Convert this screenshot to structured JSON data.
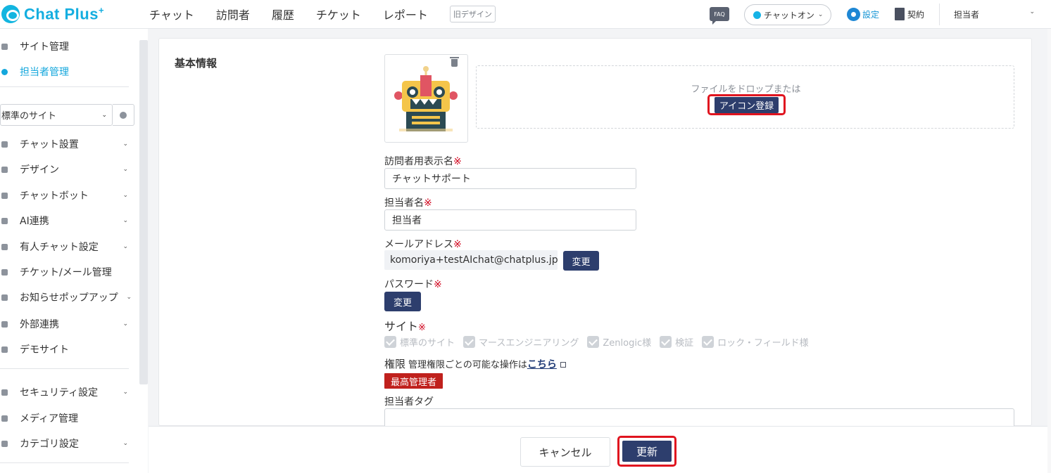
{
  "app": {
    "logo_text": "Chat Plus",
    "logo_sup": "+"
  },
  "nav": {
    "items": [
      "チャット",
      "訪問者",
      "履歴",
      "チケット",
      "レポート"
    ],
    "old_design": "旧デザイン"
  },
  "header": {
    "faq": "FAQ",
    "status": "チャットオン",
    "settings": "設定",
    "contract": "契約",
    "user": "担当者"
  },
  "sidebar": {
    "top_items": [
      {
        "label": "サイト管理"
      },
      {
        "label": "担当者管理"
      }
    ],
    "site_select": "標準のサイト",
    "items": [
      {
        "label": "チャット設置"
      },
      {
        "label": "デザイン"
      },
      {
        "label": "チャットボット"
      },
      {
        "label": "AI連携"
      },
      {
        "label": "有人チャット設定"
      },
      {
        "label": "チケット/メール管理"
      },
      {
        "label": "お知らせポップアップ"
      },
      {
        "label": "外部連携"
      },
      {
        "label": "デモサイト"
      }
    ],
    "bottom_items": [
      {
        "label": "セキュリティ設定"
      },
      {
        "label": "メディア管理"
      },
      {
        "label": "カテゴリ設定"
      }
    ]
  },
  "form": {
    "section_title": "基本情報",
    "drop_text": "ファイルをドロップまたは",
    "icon_register": "アイコン登録",
    "visitor_name_label": "訪問者用表示名",
    "visitor_name_value": "チャットサポート",
    "operator_name_label": "担当者名",
    "operator_name_value": "担当者",
    "email_label": "メールアドレス",
    "email_value": "komoriya+testAIchat@chatplus.jp",
    "change_label": "変更",
    "password_label": "パスワード",
    "required_mark": "※",
    "site_label": "サイト",
    "sites": [
      "標準のサイト",
      "マースエンジニアリング",
      "Zenlogic様",
      "検証",
      "ロック・フィールド様"
    ],
    "permission_title": "権限",
    "permission_desc": "管理権限ごとの可能な操作は",
    "permission_link": "こちら",
    "permission_badge": "最高管理者",
    "tag_label": "担当者タグ"
  },
  "footer": {
    "cancel": "キャンセル",
    "update": "更新"
  },
  "colors": {
    "brand": "#14aee0",
    "navy": "#2d3e6d",
    "highlight": "#e0141f",
    "badge": "#c0211d"
  }
}
